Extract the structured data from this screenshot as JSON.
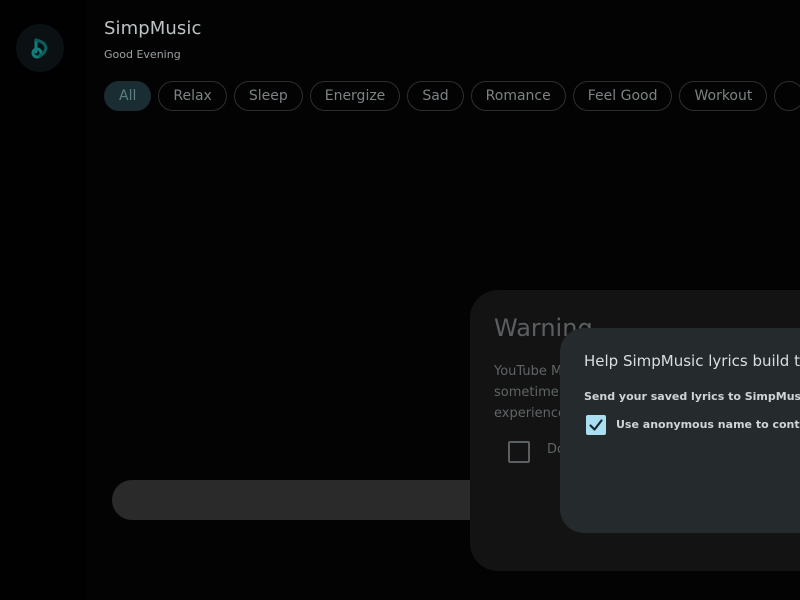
{
  "app": {
    "title": "SimpMusic",
    "greeting": "Good Evening",
    "logo_icon": "simpmusic-logo-icon",
    "accent_color": "#0f7e7a"
  },
  "moods": {
    "chips": [
      {
        "label": "All",
        "selected": true
      },
      {
        "label": "Relax",
        "selected": false
      },
      {
        "label": "Sleep",
        "selected": false
      },
      {
        "label": "Energize",
        "selected": false
      },
      {
        "label": "Sad",
        "selected": false
      },
      {
        "label": "Romance",
        "selected": false
      },
      {
        "label": "Feel Good",
        "selected": false
      },
      {
        "label": "Workout",
        "selected": false
      }
    ]
  },
  "warning_dialog": {
    "title": "Warning",
    "body_lines": [
      "YouTube M",
      "sometime",
      "experience"
    ],
    "checkbox_label": "Do",
    "checkbox_checked": false
  },
  "contribute_dialog": {
    "title": "Help SimpMusic lyrics build the",
    "description": "Send your saved lyrics to SimpMusic lyr",
    "checkbox_label": "Use anonymous name to contribu",
    "checkbox_checked": true,
    "checkbox_color": "#a9dff1"
  }
}
